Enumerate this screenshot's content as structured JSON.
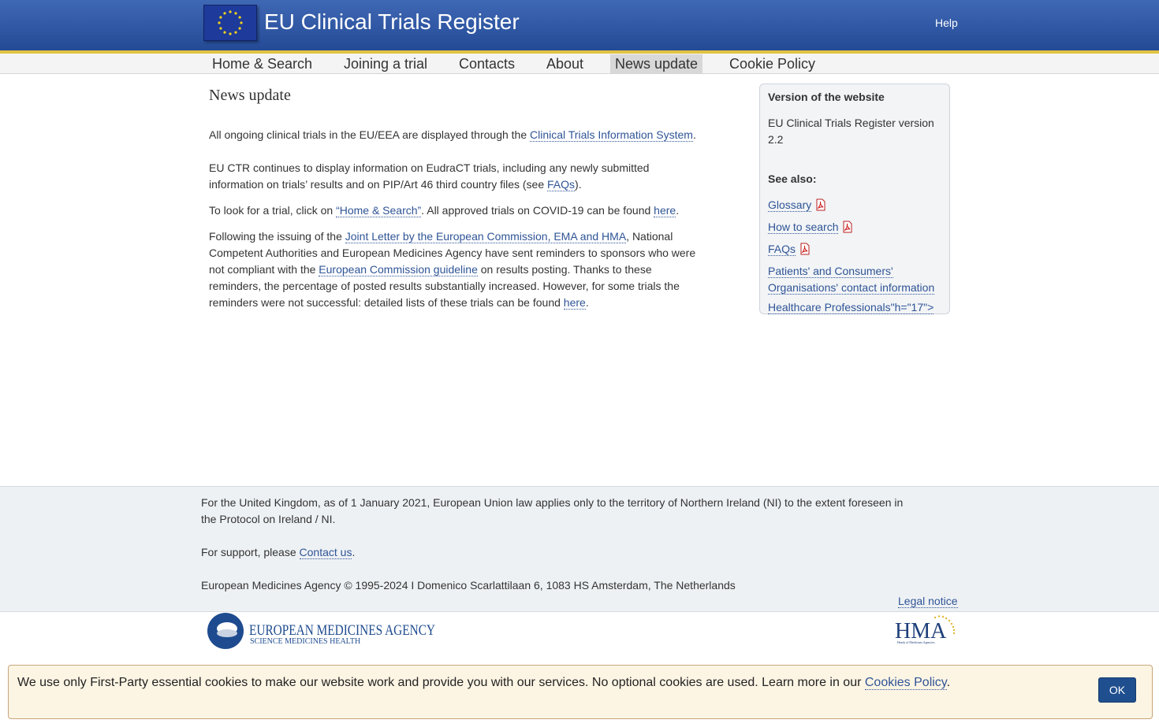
{
  "header": {
    "title": "EU Clinical Trials Register",
    "help": "Help"
  },
  "nav": {
    "items": [
      "Home & Search",
      "Joining a trial",
      "Contacts",
      "About",
      "News update",
      "Cookie Policy"
    ],
    "active": "News update"
  },
  "main": {
    "title": "News update",
    "p1": {
      "before": "All ongoing clinical trials in the EU/EEA are displayed through the ",
      "link": "Clinical Trials Information System",
      "after": "."
    },
    "p2": {
      "before": "EU CTR continues to display information on EudraCT trials, including any newly submitted information on trials’ results and on PIP/Art 46 third country files (see ",
      "link": "FAQs",
      "after": ")."
    },
    "p3": {
      "before": "To look for a trial, click on ",
      "link1": "“Home & Search”",
      "middle": ". All approved trials on COVID-19 can be found ",
      "link2": "here",
      "after": "."
    },
    "p4": {
      "before": "Following the issuing of the ",
      "link1": "Joint Letter by the European Commission, EMA and HMA",
      "middle1": ", National Competent Authorities and European Medicines Agency have sent reminders to sponsors who were not compliant with the ",
      "link2": "European Commission guideline",
      "middle2": " on results posting. Thanks to these reminders, the percentage of posted results substantially increased. However, for some trials the reminders were not successful: detailed lists of these trials can be found ",
      "link3": "here",
      "after": "."
    }
  },
  "sidebar": {
    "version_heading": "Version of the website",
    "version_text": "EU Clinical Trials Register version 2.2",
    "see_also": "See also:",
    "links": {
      "glossary": "Glossary",
      "how_to_search": "How to search",
      "faqs": "FAQs",
      "patients": "Patients' and Consumers' Organisations' contact information",
      "healthcare": "Healthcare Professionals\"h=\"17\">"
    }
  },
  "footer": {
    "uk_note": "For the United Kingdom, as of 1 January 2021, European Union law applies only to the territory of Northern Ireland (NI) to the extent foreseen in the Protocol on Ireland / NI.",
    "support_before": "For support, please ",
    "support_link": "Contact us",
    "support_after": ".",
    "copyright": "European Medicines Agency © 1995-2024 I Domenico Scarlattilaan 6, 1083 HS Amsterdam, The Netherlands",
    "legal": "Legal notice"
  },
  "logos": {
    "ema_line1": "EUROPEAN MEDICINES AGENCY",
    "ema_line2": "SCIENCE   MEDICINES   HEALTH",
    "hma": "HMA",
    "hma_sub": "Heads of Medicines Agencies"
  },
  "cookie": {
    "text_before": "We use only First-Party essential cookies to make our website work and provide you with our services. No optional cookies are used. Learn more in our ",
    "link": "Cookies Policy",
    "text_after": ".",
    "ok": "OK"
  },
  "colors": {
    "header_blue": "#2f56a4",
    "gold_stripe": "#e0c341",
    "link": "#2f5496",
    "ok_button": "#1f4f8f"
  }
}
